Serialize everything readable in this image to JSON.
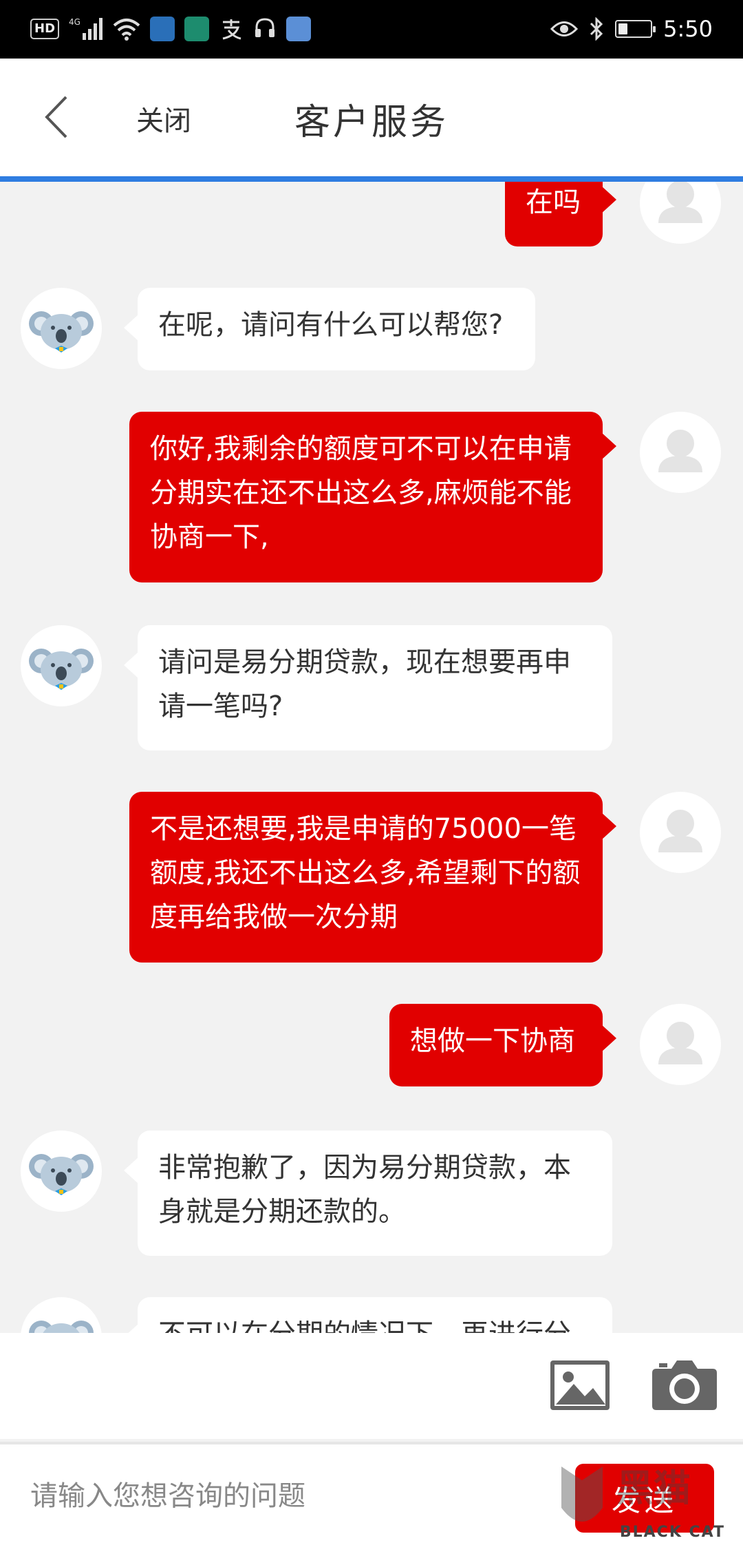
{
  "status_bar": {
    "network_badge": "HD",
    "signal": "4G",
    "time": "5:50",
    "battery_level": 0.3
  },
  "header": {
    "close_label": "关闭",
    "title": "客户服务"
  },
  "progress": {
    "value": 1.0,
    "color": "#2f7de1"
  },
  "messages": [
    {
      "role": "user",
      "text": "在吗"
    },
    {
      "role": "agent",
      "text": "在呢，请问有什么可以帮您?"
    },
    {
      "role": "user",
      "text": "你好,我剩余的额度可不可以在申请分期实在还不出这么多,麻烦能不能协商一下,"
    },
    {
      "role": "agent",
      "text": "请问是易分期贷款，现在想要再申请一笔吗?"
    },
    {
      "role": "user",
      "text": "不是还想要,我是申请的75000一笔额度,我还不出这么多,希望剩下的额度再给我做一次分期"
    },
    {
      "role": "user",
      "text": "想做一下协商"
    },
    {
      "role": "agent",
      "text": "非常抱歉了，因为易分期贷款，本身就是分期还款的。"
    },
    {
      "role": "agent",
      "text": "不可以在分期的情况下，再进行分"
    }
  ],
  "input": {
    "placeholder": "请输入您想咨询的问题",
    "send_label": "发送"
  },
  "watermark": {
    "text": "BLACK CAT"
  },
  "colors": {
    "user_bubble": "#e10000",
    "agent_bubble": "#ffffff",
    "chat_bg": "#f2f2f2",
    "accent": "#2f7de1"
  }
}
